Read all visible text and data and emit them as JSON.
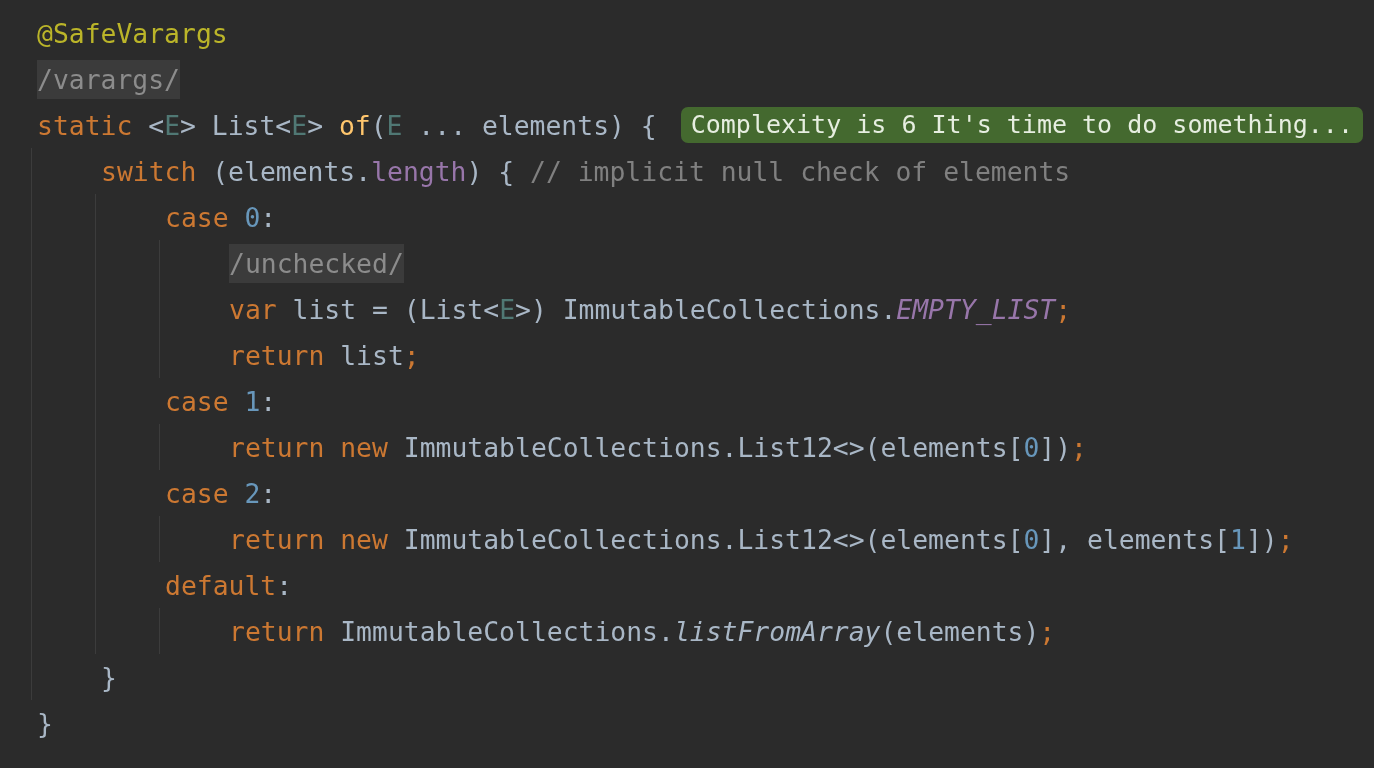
{
  "code_lines": [
    {
      "kind": "code",
      "tokens": [
        {
          "text": "@SafeVarargs",
          "kind": "annotation"
        }
      ]
    },
    {
      "kind": "fold",
      "text": "/varargs/"
    },
    {
      "kind": "code",
      "tokens": [
        {
          "text": "static",
          "kind": "keyword"
        },
        {
          "text": " <",
          "kind": "plain"
        },
        {
          "text": "E",
          "kind": "generic"
        },
        {
          "text": "> List<",
          "kind": "plain"
        },
        {
          "text": "E",
          "kind": "generic"
        },
        {
          "text": "> ",
          "kind": "plain"
        },
        {
          "text": "of",
          "kind": "method"
        },
        {
          "text": "(",
          "kind": "plain"
        },
        {
          "text": "E",
          "kind": "generic"
        },
        {
          "text": " ... elements) {",
          "kind": "plain"
        }
      ],
      "hint": "Complexity is 6 It's time to do something...",
      "children": [
        {
          "kind": "code",
          "tokens": [
            {
              "text": "switch",
              "kind": "keyword"
            },
            {
              "text": " (elements.",
              "kind": "plain"
            },
            {
              "text": "length",
              "kind": "field"
            },
            {
              "text": ") { ",
              "kind": "plain"
            },
            {
              "text": "// implicit null check of elements",
              "kind": "comment"
            }
          ],
          "children": [
            {
              "kind": "code",
              "tokens": [
                {
                  "text": "case",
                  "kind": "keyword"
                },
                {
                  "text": " 0",
                  "kind": "number"
                },
                {
                  "text": ":",
                  "kind": "plain"
                }
              ],
              "children": [
                {
                  "kind": "fold",
                  "text": "/unchecked/"
                },
                {
                  "kind": "code",
                  "tokens": [
                    {
                      "text": "var",
                      "kind": "keyword"
                    },
                    {
                      "text": " list = (List<",
                      "kind": "plain"
                    },
                    {
                      "text": "E",
                      "kind": "generic"
                    },
                    {
                      "text": ">) ImmutableCollections.",
                      "kind": "plain"
                    },
                    {
                      "text": "EMPTY_LIST",
                      "kind": "constant"
                    },
                    {
                      "text": ";",
                      "kind": "keyword"
                    }
                  ]
                },
                {
                  "kind": "code",
                  "tokens": [
                    {
                      "text": "return",
                      "kind": "keyword"
                    },
                    {
                      "text": " list",
                      "kind": "plain"
                    },
                    {
                      "text": ";",
                      "kind": "keyword"
                    }
                  ]
                }
              ]
            },
            {
              "kind": "code",
              "tokens": [
                {
                  "text": "case",
                  "kind": "keyword"
                },
                {
                  "text": " 1",
                  "kind": "number"
                },
                {
                  "text": ":",
                  "kind": "plain"
                }
              ],
              "children": [
                {
                  "kind": "code",
                  "tokens": [
                    {
                      "text": "return new",
                      "kind": "keyword"
                    },
                    {
                      "text": " ImmutableCollections.List12<>(elements[",
                      "kind": "plain"
                    },
                    {
                      "text": "0",
                      "kind": "number"
                    },
                    {
                      "text": "])",
                      "kind": "plain"
                    },
                    {
                      "text": ";",
                      "kind": "keyword"
                    }
                  ]
                }
              ]
            },
            {
              "kind": "code",
              "tokens": [
                {
                  "text": "case",
                  "kind": "keyword"
                },
                {
                  "text": " 2",
                  "kind": "number"
                },
                {
                  "text": ":",
                  "kind": "plain"
                }
              ],
              "children": [
                {
                  "kind": "code",
                  "tokens": [
                    {
                      "text": "return new",
                      "kind": "keyword"
                    },
                    {
                      "text": " ImmutableCollections.List12<>(elements[",
                      "kind": "plain"
                    },
                    {
                      "text": "0",
                      "kind": "number"
                    },
                    {
                      "text": "], elements[",
                      "kind": "plain"
                    },
                    {
                      "text": "1",
                      "kind": "number"
                    },
                    {
                      "text": "])",
                      "kind": "plain"
                    },
                    {
                      "text": ";",
                      "kind": "keyword"
                    }
                  ]
                }
              ]
            },
            {
              "kind": "code",
              "tokens": [
                {
                  "text": "default",
                  "kind": "keyword"
                },
                {
                  "text": ":",
                  "kind": "plain"
                }
              ],
              "children": [
                {
                  "kind": "code",
                  "tokens": [
                    {
                      "text": "return",
                      "kind": "keyword"
                    },
                    {
                      "text": " ImmutableCollections.",
                      "kind": "plain"
                    },
                    {
                      "text": "listFromArray",
                      "kind": "static-call"
                    },
                    {
                      "text": "(elements)",
                      "kind": "plain"
                    },
                    {
                      "text": ";",
                      "kind": "keyword"
                    }
                  ]
                }
              ]
            }
          ]
        },
        {
          "kind": "code",
          "tokens": [
            {
              "text": "}",
              "kind": "plain"
            }
          ]
        }
      ]
    },
    {
      "kind": "code",
      "tokens": [
        {
          "text": "}",
          "kind": "plain"
        }
      ]
    }
  ]
}
